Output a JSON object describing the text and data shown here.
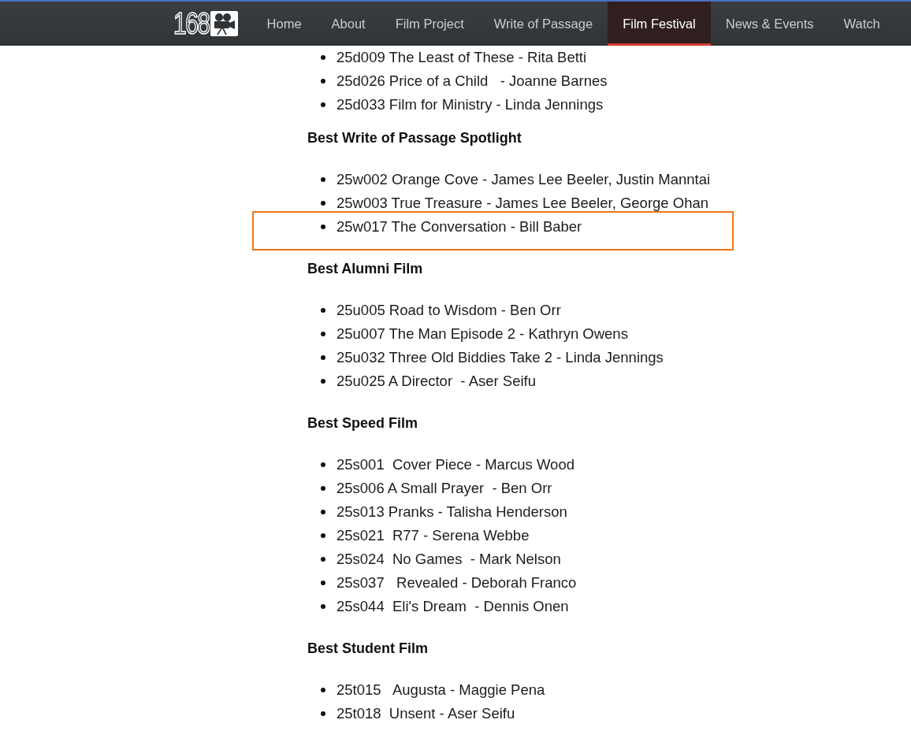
{
  "header": {
    "logo": {
      "text": "168"
    },
    "nav": [
      {
        "label": "Home",
        "selected": false
      },
      {
        "label": "About",
        "selected": false
      },
      {
        "label": "Film Project",
        "selected": false
      },
      {
        "label": "Write of Passage",
        "selected": false
      },
      {
        "label": "Film Festival",
        "selected": true
      },
      {
        "label": "News & Events",
        "selected": false
      },
      {
        "label": "Watch",
        "selected": false
      }
    ]
  },
  "sections": [
    {
      "items": [
        {
          "text": "25d009 The Least of These - Rita Betti",
          "highlighted": false
        },
        {
          "text": "25d026 Price of a Child   - Joanne Barnes",
          "highlighted": false
        },
        {
          "text": "25d033 Film for Ministry - Linda Jennings",
          "highlighted": false
        }
      ]
    },
    {
      "heading": "Best Write of Passage Spotlight",
      "items": [
        {
          "text": "25w002 Orange Cove - James Lee Beeler, Justin Manntai",
          "highlighted": false
        },
        {
          "text": "25w003 True Treasure - James Lee Beeler, George Ohan",
          "highlighted": false
        },
        {
          "text": "25w017 The Conversation - Bill Baber",
          "highlighted": true
        }
      ]
    },
    {
      "heading": "Best Alumni Film",
      "items": [
        {
          "text": "25u005 Road to Wisdom - Ben Orr",
          "highlighted": false
        },
        {
          "text": "25u007 The Man Episode 2 - Kathryn Owens",
          "highlighted": false
        },
        {
          "text": "25u032 Three Old Biddies Take 2 - Linda Jennings",
          "highlighted": false
        },
        {
          "text": "25u025 A Director  - Aser Seifu",
          "highlighted": false
        }
      ]
    },
    {
      "heading": "Best Speed Film",
      "items": [
        {
          "text": "25s001  Cover Piece - Marcus Wood",
          "highlighted": false
        },
        {
          "text": "25s006 A Small Prayer  - Ben Orr",
          "highlighted": false
        },
        {
          "text": "25s013 Pranks - Talisha Henderson",
          "highlighted": false
        },
        {
          "text": "25s021  R77 - Serena Webbe",
          "highlighted": false
        },
        {
          "text": "25s024  No Games  - Mark Nelson",
          "highlighted": false
        },
        {
          "text": "25s037   Revealed - Deborah Franco",
          "highlighted": false
        },
        {
          "text": "25s044  Eli's Dream  - Dennis Onen",
          "highlighted": false
        }
      ]
    },
    {
      "heading": "Best Student Film",
      "items": [
        {
          "text": "25t015   Augusta - Maggie Pena",
          "highlighted": false
        },
        {
          "text": "25t018  Unsent - Aser Seifu",
          "highlighted": false
        }
      ]
    }
  ]
}
